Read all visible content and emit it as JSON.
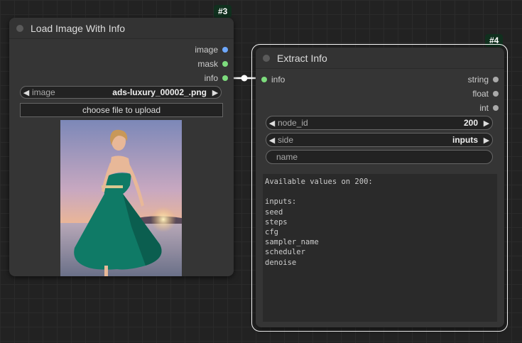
{
  "node3": {
    "badge": "#3",
    "title": "Load Image With Info",
    "outputs": [
      {
        "label": "image",
        "color": "#6ea8fe"
      },
      {
        "label": "mask",
        "color": "#7ddc7d"
      },
      {
        "label": "info",
        "color": "#7ddc7d"
      }
    ],
    "image_widget": {
      "label": "image",
      "value": "ads-luxury_00002_.png"
    },
    "upload_label": "choose file to upload"
  },
  "node4": {
    "badge": "#4",
    "title": "Extract Info",
    "input": {
      "label": "info",
      "color": "#7ddc7d"
    },
    "outputs": [
      {
        "label": "string",
        "color": "#aaaaaa"
      },
      {
        "label": "float",
        "color": "#aaaaaa"
      },
      {
        "label": "int",
        "color": "#aaaaaa"
      }
    ],
    "node_id_widget": {
      "label": "node_id",
      "value": "200"
    },
    "side_widget": {
      "label": "side",
      "value": "inputs"
    },
    "name_widget": {
      "label": "name"
    },
    "text": "Available values on 200:\n\ninputs:\nseed\nsteps\ncfg\nsampler_name\nscheduler\ndenoise"
  },
  "colors": {
    "link": "#ffffff",
    "selected_outline": "#ffffff"
  }
}
